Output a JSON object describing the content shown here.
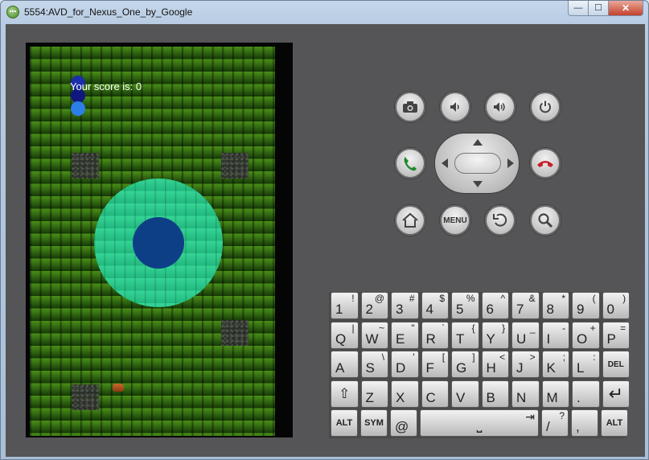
{
  "window": {
    "title": "5554:AVD_for_Nexus_One_by_Google",
    "minimize_glyph": "—",
    "maximize_glyph": "☐",
    "close_glyph": "✕"
  },
  "game": {
    "score_text": "Your score is: 0",
    "colors": {
      "snake_head": "#1b2fa8",
      "snake_mid": "#101880",
      "snake_tail": "#2c7fe6",
      "radar_outer": "#25d18e",
      "radar_inner": "#0d3f87"
    }
  },
  "controls": {
    "row1": [
      "camera-icon",
      "volume-down-icon",
      "volume-up-icon",
      "power-icon"
    ],
    "row2": [
      "call-icon",
      "dpad",
      "end-call-icon"
    ],
    "row3_menu_label": "MENU",
    "row3": [
      "home-icon",
      "menu-button",
      "back-icon",
      "search-icon"
    ]
  },
  "keyboard": {
    "row1": [
      {
        "main": "1",
        "alt": "!"
      },
      {
        "main": "2",
        "alt": "@"
      },
      {
        "main": "3",
        "alt": "#"
      },
      {
        "main": "4",
        "alt": "$"
      },
      {
        "main": "5",
        "alt": "%"
      },
      {
        "main": "6",
        "alt": "^"
      },
      {
        "main": "7",
        "alt": "&"
      },
      {
        "main": "8",
        "alt": "*"
      },
      {
        "main": "9",
        "alt": "("
      },
      {
        "main": "0",
        "alt": ")"
      }
    ],
    "row2": [
      {
        "main": "Q",
        "alt": "|"
      },
      {
        "main": "W",
        "alt": "~"
      },
      {
        "main": "E",
        "alt": "\""
      },
      {
        "main": "R",
        "alt": "`"
      },
      {
        "main": "T",
        "alt": "{"
      },
      {
        "main": "Y",
        "alt": "}"
      },
      {
        "main": "U",
        "alt": "_"
      },
      {
        "main": "I",
        "alt": "-"
      },
      {
        "main": "O",
        "alt": "+"
      },
      {
        "main": "P",
        "alt": "="
      }
    ],
    "row3": [
      {
        "main": "A",
        "alt": ""
      },
      {
        "main": "S",
        "alt": "\\"
      },
      {
        "main": "D",
        "alt": "'"
      },
      {
        "main": "F",
        "alt": "["
      },
      {
        "main": "G",
        "alt": "]"
      },
      {
        "main": "H",
        "alt": "<"
      },
      {
        "main": "J",
        "alt": ">"
      },
      {
        "main": "K",
        "alt": ";"
      },
      {
        "main": "L",
        "alt": ":"
      },
      {
        "main": "DEL",
        "alt": ""
      }
    ],
    "row4": [
      {
        "main": "⇧",
        "alt": ""
      },
      {
        "main": "Z",
        "alt": ""
      },
      {
        "main": "X",
        "alt": ""
      },
      {
        "main": "C",
        "alt": ""
      },
      {
        "main": "V",
        "alt": ""
      },
      {
        "main": "B",
        "alt": ""
      },
      {
        "main": "N",
        "alt": ""
      },
      {
        "main": "M",
        "alt": ""
      },
      {
        "main": ".",
        "alt": ""
      },
      {
        "main": "↵",
        "alt": ""
      }
    ],
    "row5": {
      "alt_left": "ALT",
      "sym": "SYM",
      "at": "@",
      "space": "⎵",
      "slash": {
        "main": "/",
        "alt": "?"
      },
      "comma": {
        "main": ",",
        "alt": ""
      },
      "alt_right": "ALT"
    }
  }
}
